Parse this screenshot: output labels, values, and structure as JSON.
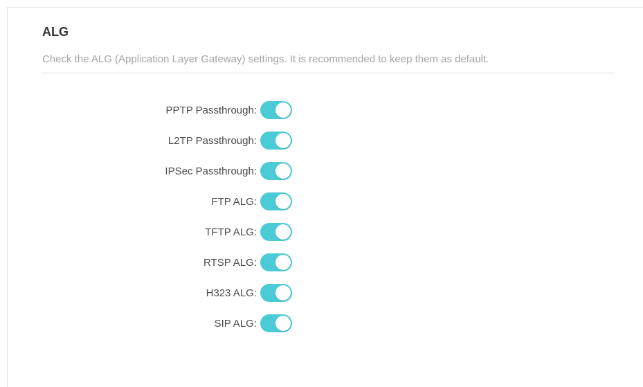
{
  "section": {
    "title": "ALG",
    "description": "Check the ALG (Application Layer Gateway) settings. It is recommended to keep them as default."
  },
  "accent_color": "#4acbd6",
  "settings": [
    {
      "label": "PPTP Passthrough:",
      "enabled": true
    },
    {
      "label": "L2TP Passthrough:",
      "enabled": true
    },
    {
      "label": "IPSec Passthrough:",
      "enabled": true
    },
    {
      "label": "FTP ALG:",
      "enabled": true
    },
    {
      "label": "TFTP ALG:",
      "enabled": true
    },
    {
      "label": "RTSP ALG:",
      "enabled": true
    },
    {
      "label": "H323 ALG:",
      "enabled": true
    },
    {
      "label": "SIP ALG:",
      "enabled": true
    }
  ]
}
